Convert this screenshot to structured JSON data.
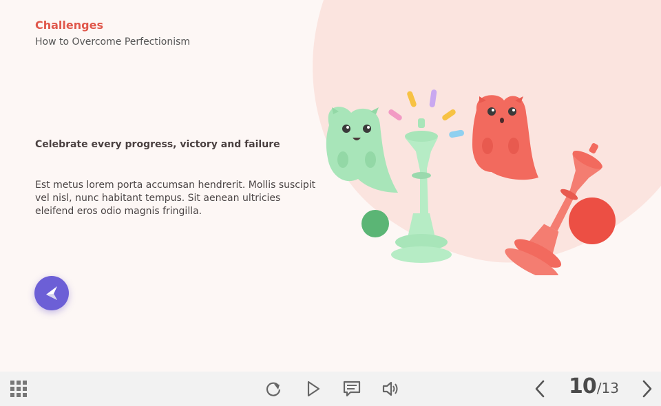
{
  "header": {
    "title": "Challenges",
    "subtitle": "How to Overcome Perfectionism"
  },
  "content": {
    "headline": "Celebrate every progress, victory and failure",
    "body": "Est metus lorem porta accumsan hendrerit. Mollis suscipit vel nisl, nunc habitant tempus. Sit aenean ultricies eleifend eros odio magnis fringilla."
  },
  "colors": {
    "accent": "#e0574b",
    "back_button": "#6c5fd6",
    "blob": "#fbe4df",
    "green_figure": "#a8e5b9",
    "red_figure": "#f26a5e"
  },
  "icons": {
    "back": "arrow-left-icon",
    "menu": "grid-icon",
    "replay": "replay-icon",
    "play": "play-icon",
    "notes": "chat-bubble-icon",
    "audio": "speaker-icon",
    "prev": "chevron-left-icon",
    "next": "chevron-right-icon"
  },
  "pagination": {
    "current": "10",
    "separator": "/",
    "total": "13"
  }
}
